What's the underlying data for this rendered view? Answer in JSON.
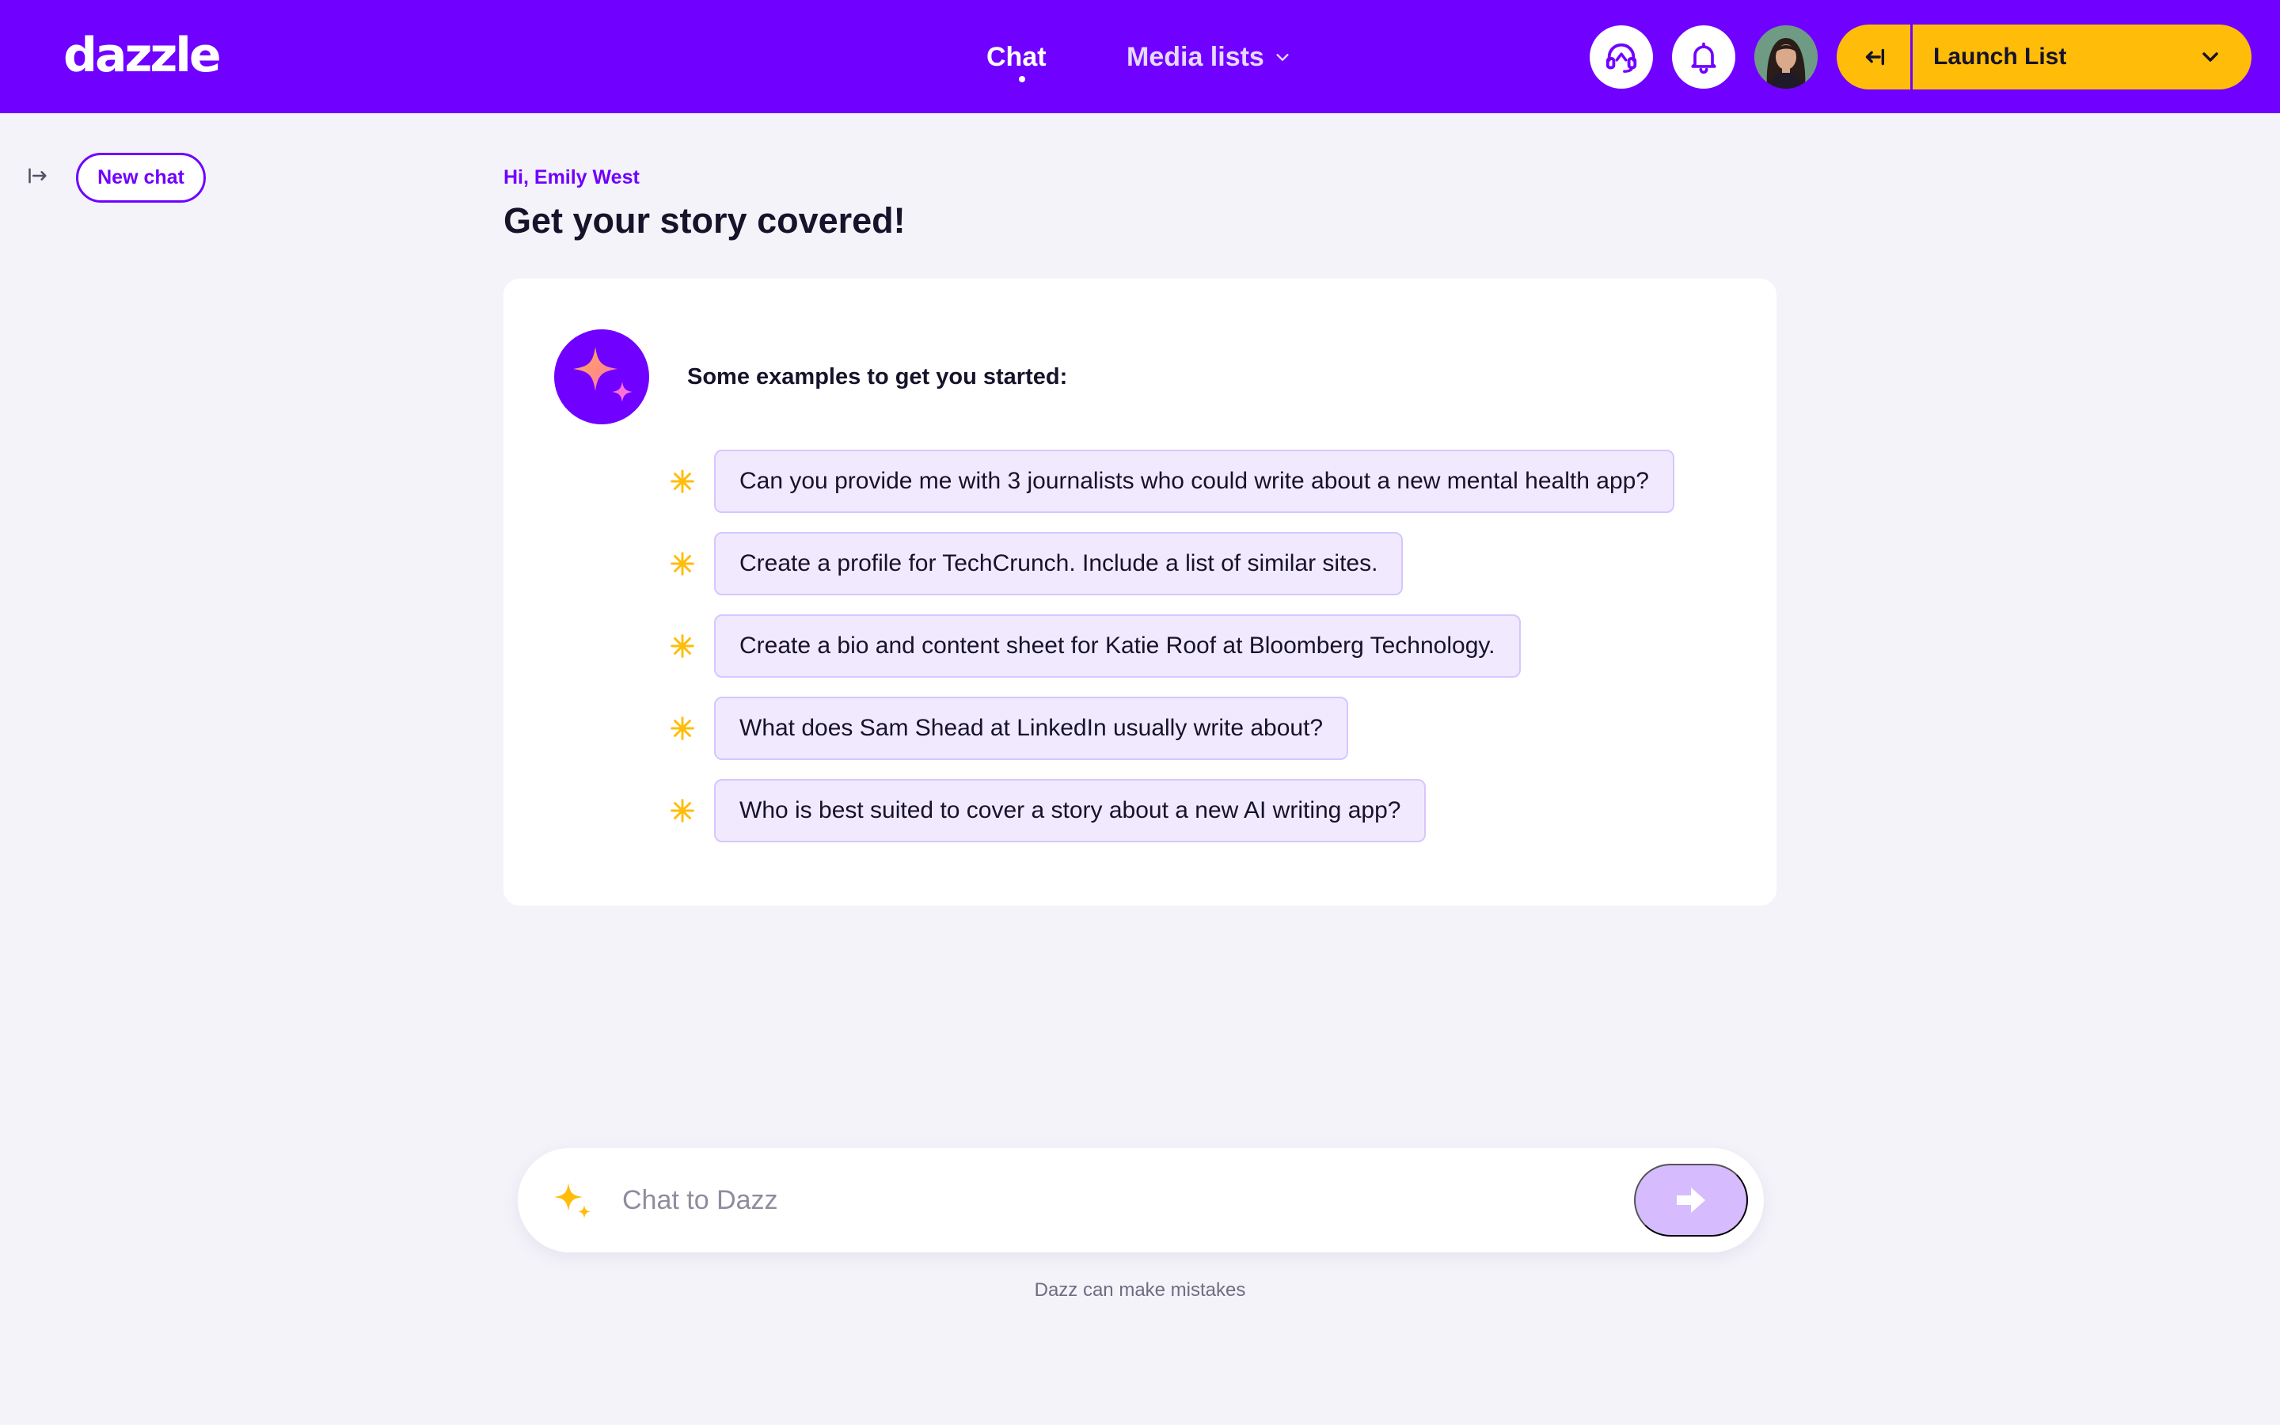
{
  "brand": {
    "logo_text": "dazzle"
  },
  "nav": {
    "chat_label": "Chat",
    "media_lists_label": "Media lists"
  },
  "header": {
    "support_icon": "headset-icon",
    "notifications_icon": "bell-icon",
    "launch_list_label": "Launch List"
  },
  "sidebar": {
    "new_chat_label": "New chat"
  },
  "main": {
    "greeting": "Hi, Emily West",
    "headline": "Get your story covered!",
    "examples_title": "Some examples to get you started:",
    "examples": [
      "Can you provide me with 3 journalists who could write about a new mental health app?",
      "Create a profile for TechCrunch. Include a list of similar sites.",
      "Create a bio and content sheet for Katie Roof at Bloomberg Technology.",
      "What does Sam Shead at LinkedIn usually write about?",
      "Who is best suited to cover a story about a new AI writing app?"
    ]
  },
  "composer": {
    "placeholder": "Chat to Dazz",
    "value": "",
    "disclaimer": "Dazz can make mistakes"
  },
  "colors": {
    "brand_purple": "#7000ff",
    "accent_yellow": "#ffbd0a",
    "chip_bg": "#f1eaff",
    "send_disabled": "#d6bcff",
    "page_bg": "#f4f3f9"
  }
}
